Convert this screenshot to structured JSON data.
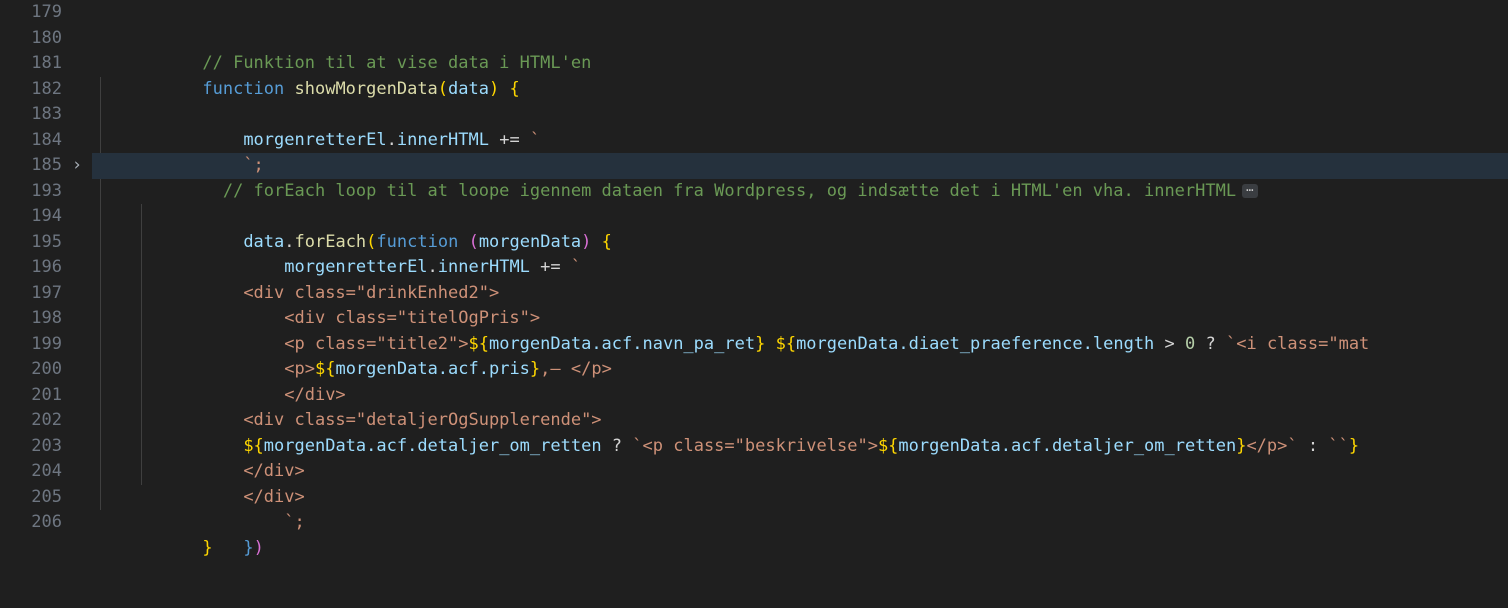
{
  "editor": {
    "language": "javascript",
    "theme": "dark-plus",
    "colors": {
      "background": "#1f1f1f",
      "line_number": "#6e7681",
      "highlight_line": "#25313d",
      "comment": "#6a9955",
      "keyword": "#569cd6",
      "function": "#dcdcaa",
      "string": "#ce9178",
      "variable": "#9cdcfe",
      "number": "#b5cea8",
      "bracket_yellow": "#ffd700",
      "bracket_magenta": "#da70d6",
      "indent_guide": "#3f3f3f"
    },
    "fold_indicator": "chevron-right-icon",
    "folded_badge": "⋯"
  },
  "lines": [
    {
      "number": "179",
      "fold": "",
      "highlight": false
    },
    {
      "number": "180",
      "fold": "",
      "highlight": false
    },
    {
      "number": "181",
      "fold": "",
      "highlight": false
    },
    {
      "number": "182",
      "fold": "",
      "highlight": false
    },
    {
      "number": "183",
      "fold": "",
      "highlight": false
    },
    {
      "number": "184",
      "fold": "",
      "highlight": false
    },
    {
      "number": "185",
      "fold": "›",
      "highlight": true
    },
    {
      "number": "193",
      "fold": "",
      "highlight": false
    },
    {
      "number": "194",
      "fold": "",
      "highlight": false
    },
    {
      "number": "195",
      "fold": "",
      "highlight": false
    },
    {
      "number": "196",
      "fold": "",
      "highlight": false
    },
    {
      "number": "197",
      "fold": "",
      "highlight": false
    },
    {
      "number": "198",
      "fold": "",
      "highlight": false
    },
    {
      "number": "199",
      "fold": "",
      "highlight": false
    },
    {
      "number": "200",
      "fold": "",
      "highlight": false
    },
    {
      "number": "201",
      "fold": "",
      "highlight": false
    },
    {
      "number": "202",
      "fold": "",
      "highlight": false
    },
    {
      "number": "203",
      "fold": "",
      "highlight": false
    },
    {
      "number": "204",
      "fold": "",
      "highlight": false
    },
    {
      "number": "205",
      "fold": "",
      "highlight": false
    },
    {
      "number": "206",
      "fold": "",
      "highlight": false
    }
  ],
  "code": {
    "l179": "",
    "l180_comment": "// Funktion til at vise data i HTML'en",
    "l181_keyword": "function",
    "l181_name": " showMorgenData",
    "l181_paren_open": "(",
    "l181_param": "data",
    "l181_paren_close": ")",
    "l181_brace": " {",
    "l182_obj": "morgenretterEl",
    "l182_dot": ".",
    "l182_prop": "innerHTML",
    "l182_op": " += ",
    "l182_tick": "`",
    "l183": "`;",
    "l184": "",
    "l185_comment": "// forEach loop til at loope igennem dataen fra Wordpress, og indsætte det i HTML'en vha. innerHTML",
    "l185_fold_badge": "⋯",
    "l193_obj": "data",
    "l193_dot": ".",
    "l193_method": "forEach",
    "l193_paren": "(",
    "l193_keyword": "function",
    "l193_space": " ",
    "l193_paren2": "(",
    "l193_param": "morgenData",
    "l193_paren2close": ")",
    "l193_brace": " {",
    "l194_obj": "morgenretterEl",
    "l194_dot": ".",
    "l194_prop": "innerHTML",
    "l194_op": " += ",
    "l194_tick": "`",
    "l195": "<div class=\"drinkEnhed2\">",
    "l196": "<div class=\"titelOgPris\">",
    "l197_a": "<p class=\"title2\">",
    "l197_sub1_open": "${",
    "l197_sub1_expr": "morgenData.acf.navn_pa_ret",
    "l197_sub1_close": "}",
    "l197_space": " ",
    "l197_sub2_open": "${",
    "l197_sub2_expr": "morgenData.diaet_praeference.length",
    "l197_gt": " > ",
    "l197_num": "0",
    "l197_q": " ? ",
    "l197_tick": "`",
    "l197_tail": "<i class=\"mat",
    "l198_a": "<p>",
    "l198_sub_open": "${",
    "l198_sub_expr": "morgenData.acf.pris",
    "l198_sub_close": "}",
    "l198_tail": ",– ",
    "l198_close": "</p>",
    "l199": "</div>",
    "l200": "<div class=\"detaljerOgSupplerende\">",
    "l201_sub1_open": "${",
    "l201_sub1_expr": "morgenData.acf.detaljer_om_retten",
    "l201_q": " ? ",
    "l201_tick1": "`",
    "l201_p": "<p class=\"beskrivelse\">",
    "l201_sub2_open": "${",
    "l201_sub2_expr": "morgenData.acf.detaljer_om_retten",
    "l201_sub2_close": "}",
    "l201_pclose": "</p>",
    "l201_tick2": "`",
    "l201_colon": " : ",
    "l201_empty": "``",
    "l201_endbrace": "}",
    "l202": "</div>",
    "l203": "</div>",
    "l204": "`;",
    "l205_brace": "}",
    "l205_paren": ")",
    "l206_brace": "}"
  }
}
